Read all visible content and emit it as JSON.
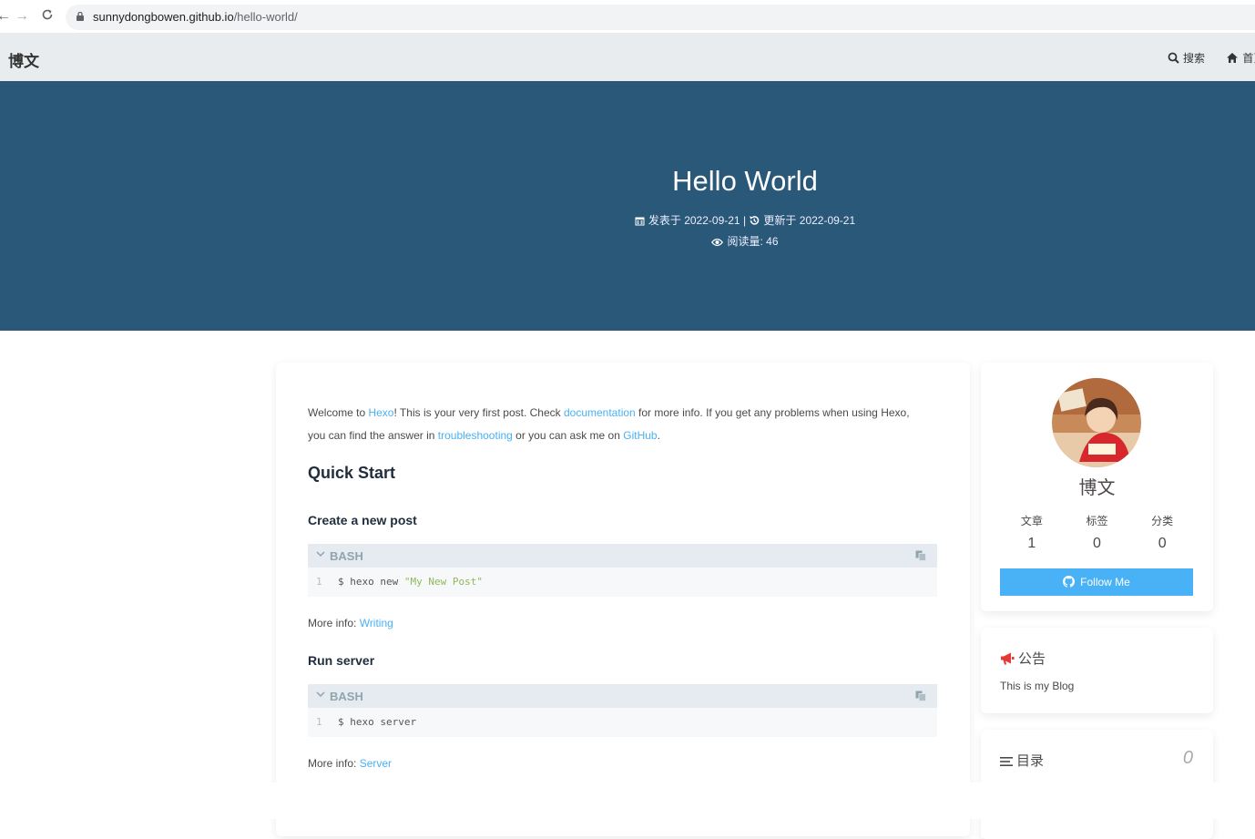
{
  "browser": {
    "url_host": "sunnydongbowen.github.io",
    "url_path": "/hello-world/"
  },
  "nav": {
    "brand": "博文",
    "search_label": "搜索",
    "home_label": "首页"
  },
  "hero": {
    "title": "Hello World",
    "published_label": "发表于",
    "published_date": "2022-09-21",
    "separator": "|",
    "updated_label": "更新于",
    "updated_date": "2022-09-21",
    "views_label": "阅读量:",
    "views_count": "46"
  },
  "post": {
    "intro_1": "Welcome to ",
    "link_hexo": "Hexo",
    "intro_2": "! This is your very first post. Check ",
    "link_documentation": "documentation",
    "intro_3": " for more info. If you get any problems when using Hexo,",
    "intro_4": "you can find the answer in ",
    "link_troubleshooting": "troubleshooting",
    "intro_5": " or you can ask me on ",
    "link_github": "GitHub",
    "intro_6": ".",
    "h2_quick_start": "Quick Start",
    "h3_create": "Create a new post",
    "code1_lang": "BASH",
    "code1_num": "1",
    "code1_cmd": "$ hexo new ",
    "code1_str": "\"My New Post\"",
    "more_info_label": "More info: ",
    "link_writing": "Writing",
    "h3_run": "Run server",
    "code2_lang": "BASH",
    "code2_num": "1",
    "code2_cmd": "$ hexo server",
    "more_info_label_2": "More info: ",
    "link_server": "Server"
  },
  "author": {
    "name": "博文",
    "stats": [
      {
        "label": "文章",
        "value": "1"
      },
      {
        "label": "标签",
        "value": "0"
      },
      {
        "label": "分类",
        "value": "0"
      }
    ],
    "follow_label": "Follow Me"
  },
  "announcement": {
    "title": "公告",
    "body": "This is my Blog"
  },
  "toc": {
    "title": "目录",
    "percent": "0"
  },
  "colors": {
    "hero_bg": "#295879",
    "accent": "#49b1f5",
    "nav_bg": "#e9ecef",
    "announce_icon": "#e53935"
  }
}
